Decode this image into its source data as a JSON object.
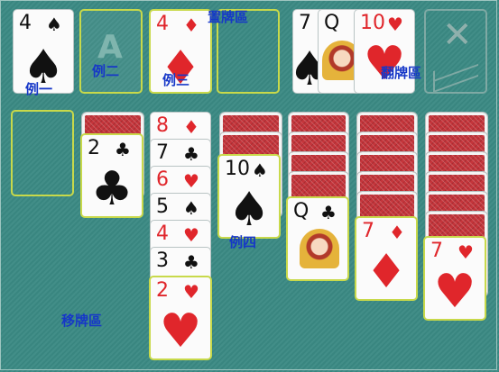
{
  "labels": {
    "reserve_area": "置牌區",
    "flip_area": "翻牌區",
    "move_area": "移牌區",
    "example_1": "例一",
    "example_2": "例二",
    "example_3": "例三",
    "example_4": "例四"
  },
  "foundations": {
    "card_1": {
      "rank": "4",
      "suit": "♠",
      "color": "black"
    },
    "slot_2_placeholder": "A",
    "card_3": {
      "rank": "4",
      "suit": "♦",
      "color": "red"
    }
  },
  "waste": {
    "card_a": {
      "rank": "7",
      "suit": "♠",
      "color": "black"
    },
    "card_b": {
      "rank": "Q",
      "suit": "♠",
      "color": "black"
    },
    "card_c": {
      "rank": "10",
      "suit": "♥",
      "color": "red"
    }
  },
  "stock": {
    "recycle_symbol": "✕"
  },
  "tableau": {
    "col2_top": {
      "rank": "2",
      "suit": "♣",
      "color": "black"
    },
    "col3": [
      {
        "rank": "8",
        "suit": "♦",
        "color": "red"
      },
      {
        "rank": "7",
        "suit": "♣",
        "color": "black"
      },
      {
        "rank": "6",
        "suit": "♥",
        "color": "red"
      },
      {
        "rank": "5",
        "suit": "♠",
        "color": "black"
      },
      {
        "rank": "4",
        "suit": "♥",
        "color": "red"
      },
      {
        "rank": "3",
        "suit": "♣",
        "color": "black"
      },
      {
        "rank": "2",
        "suit": "♥",
        "color": "red"
      }
    ],
    "col4_top": {
      "rank": "10",
      "suit": "♠",
      "color": "black"
    },
    "col5_top": {
      "rank": "Q",
      "suit": "♣",
      "color": "black"
    },
    "col6_top": {
      "rank": "7",
      "suit": "♦",
      "color": "red"
    },
    "col7_top": {
      "rank": "7",
      "suit": "♥",
      "color": "red"
    }
  },
  "colors": {
    "felt": "#3b8a84",
    "highlight": "#c8d94a",
    "label": "#1637c8",
    "card_red": "#e0262b"
  }
}
